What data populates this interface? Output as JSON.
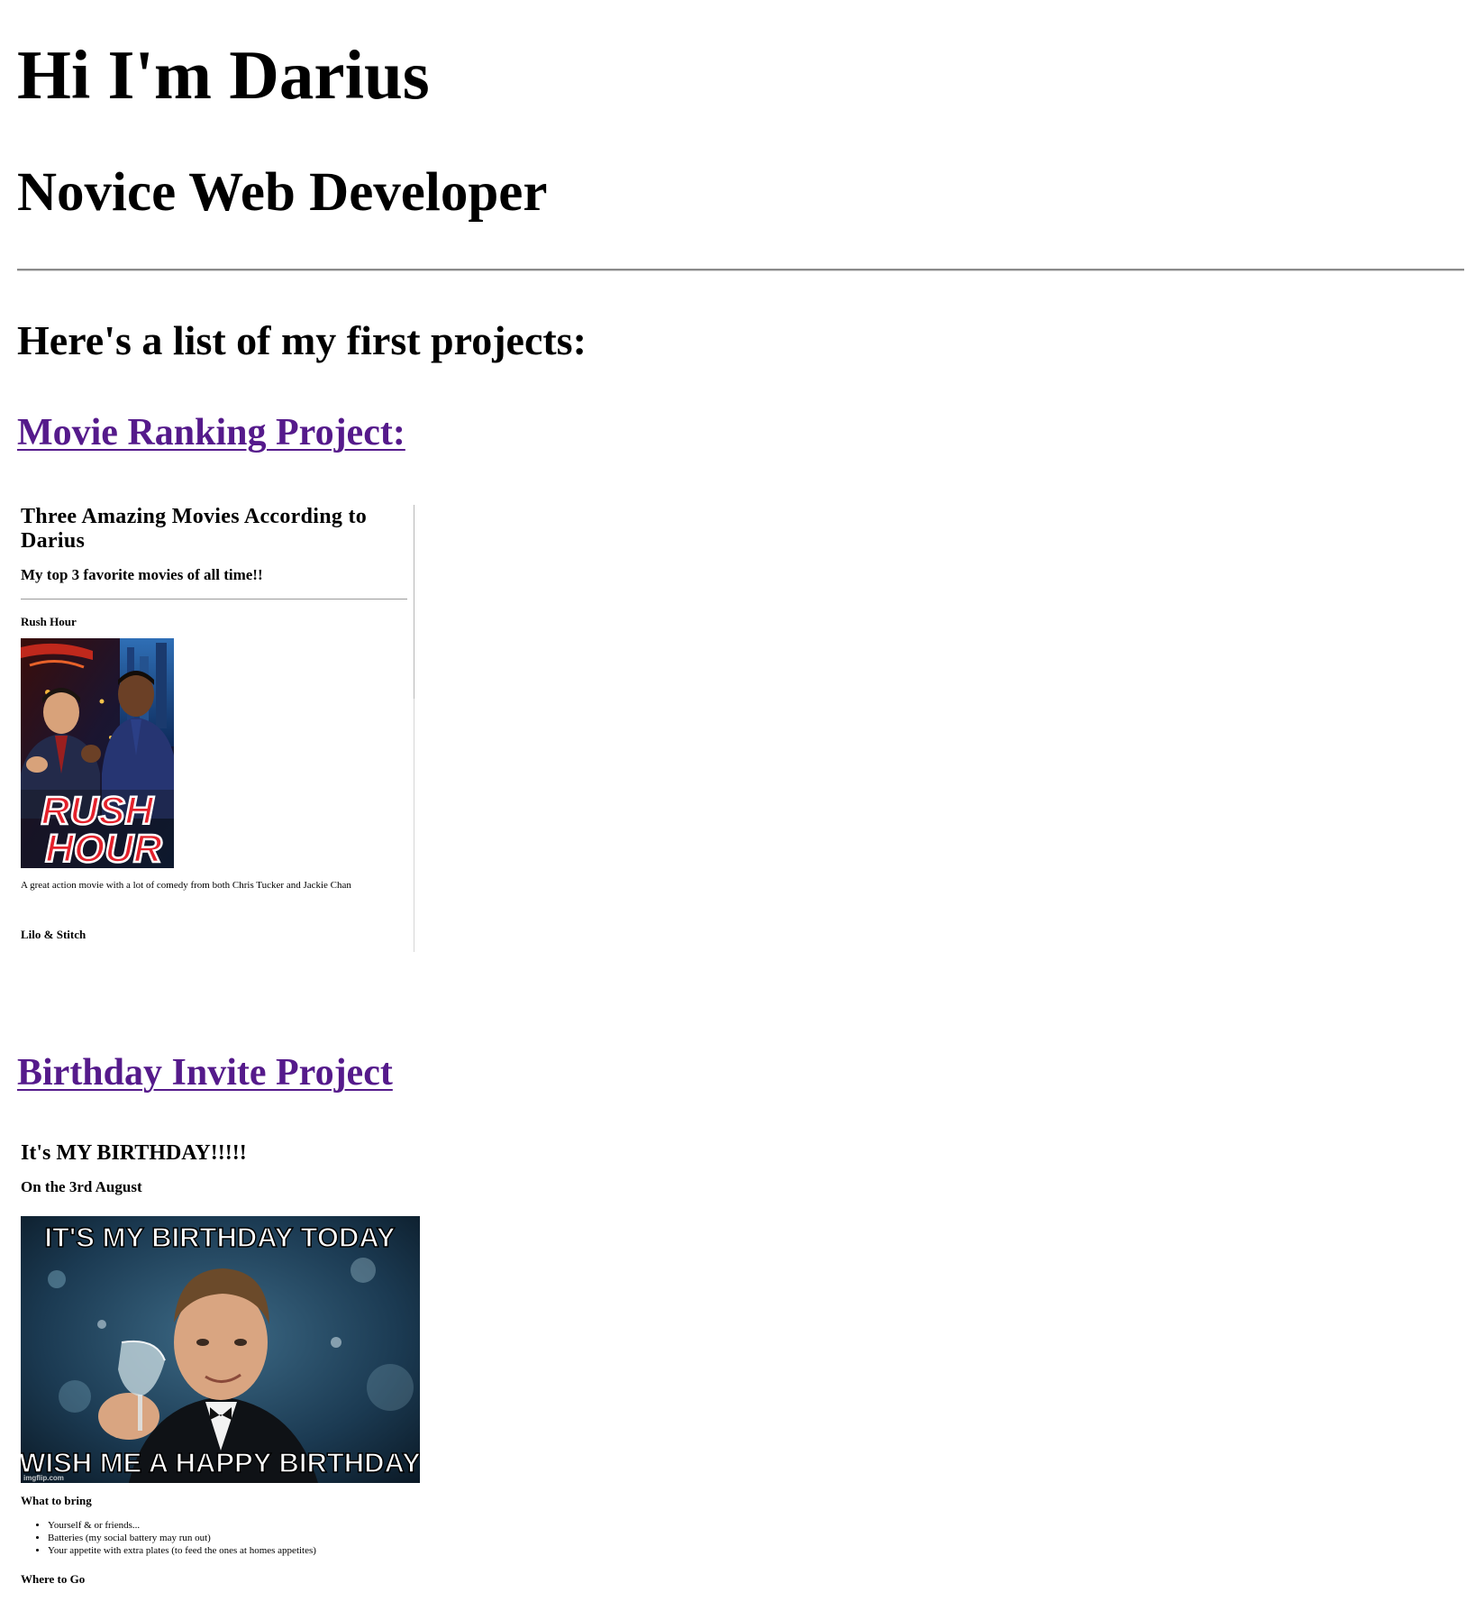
{
  "header": {
    "name": "Hi I'm Darius",
    "role": "Novice Web Developer"
  },
  "projects_heading": "Here's a list of my first projects:",
  "projects": {
    "movie": {
      "link_label": "Movie Ranking Project:",
      "preview": {
        "title": "Three Amazing Movies According to Darius",
        "subtitle": "My top 3 favorite movies of all time!!",
        "movies": [
          {
            "name": "Rush Hour",
            "poster_text_line1": "RUSH",
            "poster_text_line2": "HOUR",
            "description": "A great action movie with a lot of comedy from both Chris Tucker and Jackie Chan"
          },
          {
            "name": "Lilo & Stitch"
          }
        ]
      }
    },
    "birthday": {
      "link_label": "Birthday Invite Project",
      "preview": {
        "title": "It's MY BIRTHDAY!!!!!",
        "date": "On the 3rd August",
        "meme": {
          "top_text": "IT'S MY BIRTHDAY TODAY",
          "bottom_text": "WISH ME A HAPPY BIRTHDAY",
          "watermark": "imgflip.com"
        },
        "bring_heading": "What to bring",
        "bring_items": [
          "Yourself & or friends...",
          "Batteries (my social battery may run out)",
          "Your appetite with extra plates (to feed the ones at homes appetites)"
        ],
        "where_heading": "Where to Go"
      }
    }
  },
  "colors": {
    "link_visited": "#551a8b",
    "text": "#000000",
    "background": "#ffffff"
  }
}
